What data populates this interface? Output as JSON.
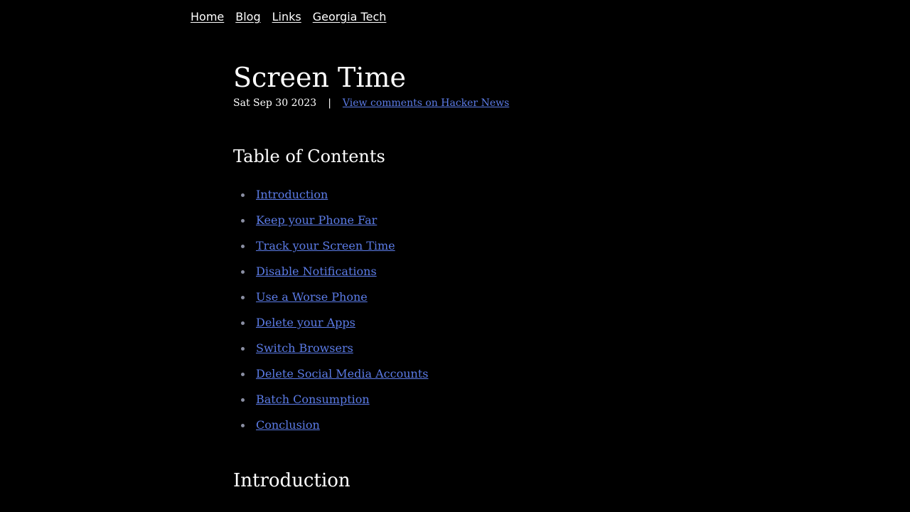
{
  "nav": {
    "items": [
      {
        "label": "Home"
      },
      {
        "label": "Blog"
      },
      {
        "label": "Links"
      },
      {
        "label": "Georgia Tech"
      }
    ]
  },
  "post": {
    "title": "Screen Time",
    "date": "Sat Sep 30 2023",
    "separator": "|",
    "comments_link": "View comments on Hacker News"
  },
  "toc": {
    "heading": "Table of Contents",
    "items": [
      {
        "label": "Introduction"
      },
      {
        "label": "Keep your Phone Far"
      },
      {
        "label": "Track your Screen Time"
      },
      {
        "label": "Disable Notifications"
      },
      {
        "label": "Use a Worse Phone"
      },
      {
        "label": "Delete your Apps"
      },
      {
        "label": "Switch Browsers"
      },
      {
        "label": "Delete Social Media Accounts"
      },
      {
        "label": "Batch Consumption"
      },
      {
        "label": "Conclusion"
      }
    ]
  },
  "section": {
    "heading": "Introduction"
  },
  "colors": {
    "background": "#000000",
    "text": "#ffffff",
    "link": "#5b7be6",
    "bullet": "#8a8fa3"
  }
}
